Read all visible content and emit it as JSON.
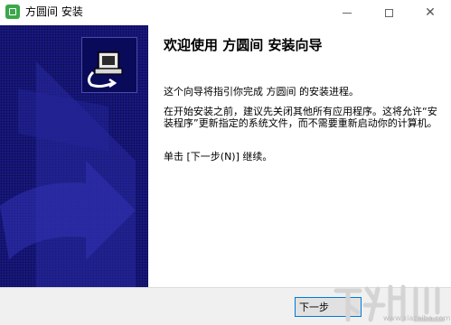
{
  "window": {
    "title": "方圆间 安装",
    "minimize_glyph": "—",
    "maximize_glyph": "□",
    "close_glyph": "✕"
  },
  "content": {
    "heading": "欢迎使用 方圆间 安装向导",
    "paragraph_1": "这个向导将指引你完成 方圆间 的安装进程。",
    "paragraph_2": "在开始安装之前，建议先关闭其他所有应用程序。这将允许“安装程序”更新指定的系统文件，而不需要重新启动你的计算机。",
    "paragraph_3": "单击 [下一步(N)] 继续。"
  },
  "footer": {
    "next_label": "下一步"
  },
  "watermark": {
    "site": "www.xiazaiba.com"
  },
  "colors": {
    "sidebar_bg": "#1a1a8a",
    "button_border": "#0078d7",
    "app_icon": "#3aa84a"
  },
  "icons": {
    "app": "app-icon",
    "installer": "installer-computer-icon",
    "watermark": "download-site-logo"
  }
}
